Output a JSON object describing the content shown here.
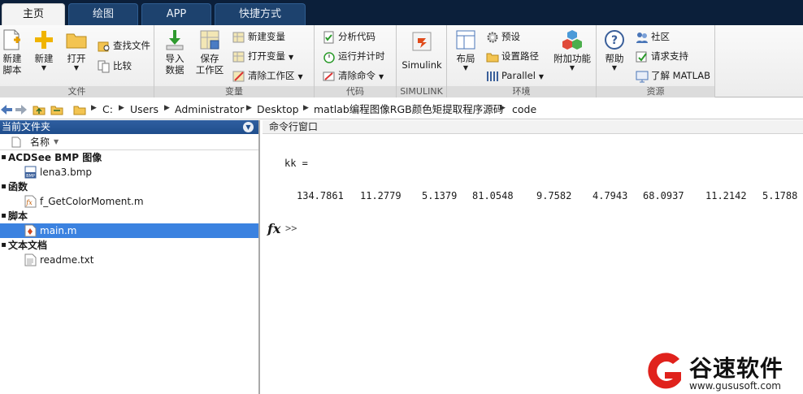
{
  "tabs": [
    {
      "label": "主页",
      "active": true
    },
    {
      "label": "绘图",
      "active": false
    },
    {
      "label": "APP",
      "active": false
    },
    {
      "label": "快捷方式",
      "active": false
    }
  ],
  "ribbon": {
    "file": {
      "group_label": "文件",
      "new_script": "新建\n脚本",
      "new": "新建",
      "open": "打开",
      "find_files": "查找文件",
      "compare": "比较"
    },
    "variable": {
      "group_label": "变量",
      "import_data": "导入\n数据",
      "save_workspace": "保存\n工作区",
      "new_variable": "新建变量",
      "open_variable": "打开变量",
      "clear_workspace": "清除工作区"
    },
    "code": {
      "group_label": "代码",
      "analyze_code": "分析代码",
      "run_and_time": "运行并计时",
      "clear_commands": "清除命令"
    },
    "simulink": {
      "group_label": "SIMULINK",
      "simulink": "Simulink"
    },
    "environment": {
      "group_label": "环境",
      "layout": "布局",
      "preferences": "预设",
      "set_path": "设置路径",
      "parallel": "Parallel",
      "addons": "附加功能"
    },
    "resources": {
      "group_label": "资源",
      "help": "帮助",
      "community": "社区",
      "request_support": "请求支持",
      "learn_matlab": "了解 MATLAB"
    }
  },
  "address": {
    "crumbs": [
      "C:",
      "Users",
      "Administrator",
      "Desktop",
      "matlab编程图像RGB颜色矩提取程序源码",
      "code"
    ]
  },
  "current_folder": {
    "title": "当前文件夹",
    "column_name": "名称",
    "groups": [
      {
        "label": "ACDSee BMP 图像",
        "files": [
          {
            "name": "lena3.bmp",
            "icon": "bmp-icon",
            "selected": false
          }
        ]
      },
      {
        "label": "函数",
        "files": [
          {
            "name": "f_GetColorMoment.m",
            "icon": "function-icon",
            "selected": false
          }
        ]
      },
      {
        "label": "脚本",
        "files": [
          {
            "name": "main.m",
            "icon": "script-icon",
            "selected": true
          }
        ]
      },
      {
        "label": "文本文档",
        "files": [
          {
            "name": "readme.txt",
            "icon": "text-file-icon",
            "selected": false
          }
        ]
      }
    ]
  },
  "command_window": {
    "title": "命令行窗口",
    "output_var": "kk =",
    "values": [
      "134.7861",
      "11.2779",
      "5.1379",
      "81.0548",
      "9.7582",
      "4.7943",
      "68.0937",
      "11.2142",
      "5.1788"
    ],
    "fx_symbol": "fx",
    "prompt": ">>"
  },
  "watermark": {
    "brand": "谷速软件",
    "url": "www.gususoft.com"
  },
  "colors": {
    "tabbar_bg": "#0b1f3a",
    "panel_header": "#1f4d8c",
    "selection": "#3b82e0",
    "watermark_red": "#e0221c"
  }
}
